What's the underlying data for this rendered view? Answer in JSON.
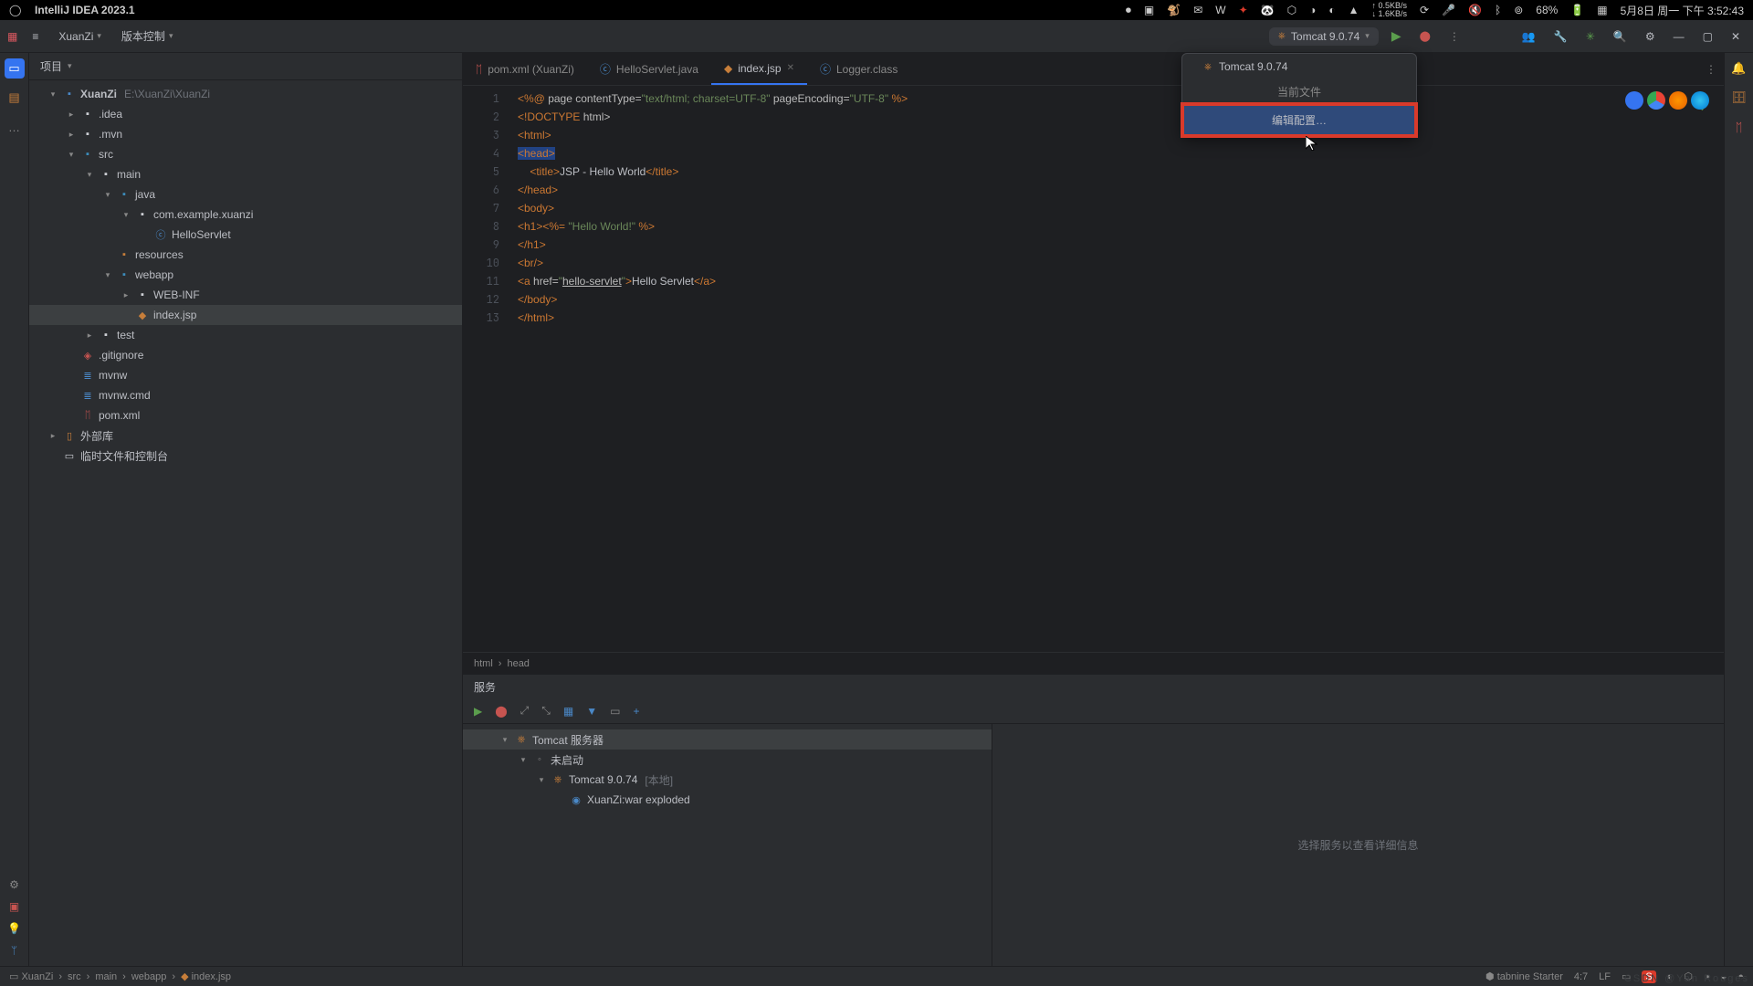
{
  "macbar": {
    "app": "IntelliJ IDEA 2023.1",
    "net_up": "0.5KB/s",
    "net_down": "1.6KB/s",
    "battery": "68%",
    "date": "5月8日 周一 下午 3:52:43"
  },
  "toolbar": {
    "project": "XuanZi",
    "vcs": "版本控制",
    "run_config": "Tomcat 9.0.74"
  },
  "dropdown": {
    "config": "Tomcat 9.0.74",
    "current": "当前文件",
    "edit": "编辑配置…"
  },
  "project": {
    "title": "项目",
    "root": "XuanZi",
    "root_path": "E:\\XuanZi\\XuanZi",
    "idea": ".idea",
    "mvn": ".mvn",
    "src": "src",
    "main": "main",
    "java": "java",
    "pkg": "com.example.xuanzi",
    "servlet": "HelloServlet",
    "resources": "resources",
    "webapp": "webapp",
    "webinf": "WEB-INF",
    "indexjsp": "index.jsp",
    "test": "test",
    "gitignore": ".gitignore",
    "mvnw": "mvnw",
    "mvnwcmd": "mvnw.cmd",
    "pom": "pom.xml",
    "extlib": "外部库",
    "scratch": "临时文件和控制台"
  },
  "tabs": {
    "pom": "pom.xml (XuanZi)",
    "servlet": "HelloServlet.java",
    "index": "index.jsp",
    "logger": "Logger.class"
  },
  "code": {
    "lines": 13,
    "l1a": "<%@",
    "l1b": " page ",
    "l1c": "contentType=",
    "l1d": "\"text/html; charset=UTF-8\"",
    "l1e": " pageEncoding=",
    "l1f": "\"UTF-8\"",
    "l1g": " %>",
    "l2a": "<!DOCTYPE ",
    "l2b": "html>",
    "l3": "<html>",
    "l4": "<head>",
    "l5a": "    <title>",
    "l5b": "JSP - Hello World",
    "l5c": "</title>",
    "l6": "</head>",
    "l7": "<body>",
    "l8a": "<h1>",
    "l8b": "<%=",
    "l8c": " \"Hello World!\" ",
    "l8d": "%>",
    "l9": "</h1>",
    "l10": "<br/>",
    "l11a": "<a ",
    "l11b": "href=",
    "l11c": "\"",
    "l11d": "hello-servlet",
    "l11e": "\"",
    "l11f": ">",
    "l11g": "Hello Servlet",
    "l11h": "</a>",
    "l12": "</body>",
    "l13": "</html>"
  },
  "breadcrumb_editor": {
    "a": "html",
    "b": "head"
  },
  "services": {
    "title": "服务",
    "tomcat_server": "Tomcat 服务器",
    "not_started": "未启动",
    "tomcat": "Tomcat 9.0.74",
    "tomcat_suffix": " [本地]",
    "artifact": "XuanZi:war exploded",
    "detail": "选择服务以查看详细信息"
  },
  "statusbar": {
    "crumb_root": "XuanZi",
    "crumb_src": "src",
    "crumb_main": "main",
    "crumb_webapp": "webapp",
    "crumb_file": "index.jsp",
    "tabnine": "tabnine Starter",
    "pos": "4:7",
    "lf": "LF",
    "watermark": "CSDN @Yan Rouges"
  }
}
